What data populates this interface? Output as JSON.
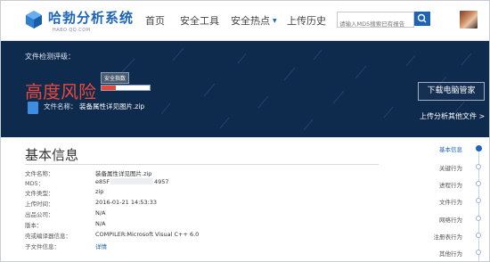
{
  "header": {
    "logo_title": "哈勃分析系统",
    "logo_subtitle": "HABO.QQ.COM",
    "nav": [
      {
        "label": "首页"
      },
      {
        "label": "安全工具"
      },
      {
        "label": "安全热点"
      },
      {
        "label": "上传历史"
      }
    ],
    "search_placeholder": "请输入MD5搜索已有报告"
  },
  "banner": {
    "grade_label": "文件检测评级：",
    "risk_level": "高度风险",
    "safety_index_label": "安全指数",
    "safety_index_fraction": 0.3,
    "file_name_label": "文件名称：",
    "file_name": "装备属性详见图片.zip",
    "download_button": "下载电脑管家",
    "upload_link": "上传分析其他文件 >"
  },
  "basic_info": {
    "title": "基本信息",
    "rows": [
      {
        "key": "文件名称：",
        "value": "装备属性详见图片.zip"
      },
      {
        "key": "MD5：",
        "value_prefix": "e85F",
        "value_suffix": "4957"
      },
      {
        "key": "文件类型：",
        "value": "zip"
      },
      {
        "key": "上传时间：",
        "value": "2016-01-21 14:53:33"
      },
      {
        "key": "出品公司：",
        "value": "N/A"
      },
      {
        "key": "版本：",
        "value": "N/A"
      },
      {
        "key": "壳或编译器信息：",
        "value": "COMPILER:Microsoft Visual C++ 6.0"
      },
      {
        "key": "子文件信息：",
        "value": "详情"
      }
    ]
  },
  "sidebar": {
    "items": [
      {
        "label": "基本信息",
        "active": true
      },
      {
        "label": "关键行为",
        "active": false
      },
      {
        "label": "进程行为",
        "active": false
      },
      {
        "label": "文件行为",
        "active": false
      },
      {
        "label": "网络行为",
        "active": false
      },
      {
        "label": "注册表行为",
        "active": false
      },
      {
        "label": "其他行为",
        "active": false
      }
    ]
  },
  "colors": {
    "brand": "#1b64b7",
    "banner_bg": "#0e2a4d",
    "risk": "#e6483a"
  }
}
